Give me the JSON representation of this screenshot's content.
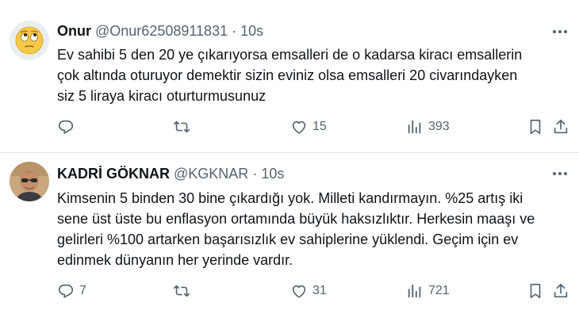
{
  "tweets": [
    {
      "avatar": "rolling-eyes-emoji-avatar",
      "name": "Onur",
      "handle": "@Onur62508911831",
      "dot": "·",
      "time": "10s",
      "text_lines": [
        "Ev sahibi 5 den 20 ye çıkarıyorsa emsalleri de o kadarsa kiracı emsallerin",
        "çok altında oturuyor demektir sizin eviniz olsa emsalleri 20 civarındayken",
        "siz 5 liraya kiracı oturturmusunuz"
      ],
      "reply_count": "",
      "retweet_count": "",
      "like_count": "15",
      "view_count": "393"
    },
    {
      "avatar": "profile-photo-avatar",
      "name": "KADRİ GÖKNAR",
      "handle": "@KGKNAR",
      "dot": "·",
      "time": "10s",
      "text_lines": [
        "Kimsenin 5 binden 30 bine çıkardığı yok. Milleti kandırmayın. %25 artış iki",
        "sene üst üste bu enflasyon ortamında büyük haksızlıktır. Herkesin maaşı ve",
        "gelirleri %100 artarken başarısızlık  ev sahiplerine yüklendi. Geçim için ev",
        "edinmek dünyanın her yerinde vardır."
      ],
      "reply_count": "7",
      "retweet_count": "",
      "like_count": "31",
      "view_count": "721"
    }
  ],
  "icons": {
    "reply": "reply-icon",
    "retweet": "retweet-icon",
    "like": "heart-icon",
    "views": "views-chart-icon",
    "bookmark": "bookmark-icon",
    "share": "share-icon",
    "more": "more-dots-icon"
  },
  "colors": {
    "text": "#0f1419",
    "secondary": "#536471",
    "divider": "#e7e9ea",
    "background": "#ffffff"
  }
}
